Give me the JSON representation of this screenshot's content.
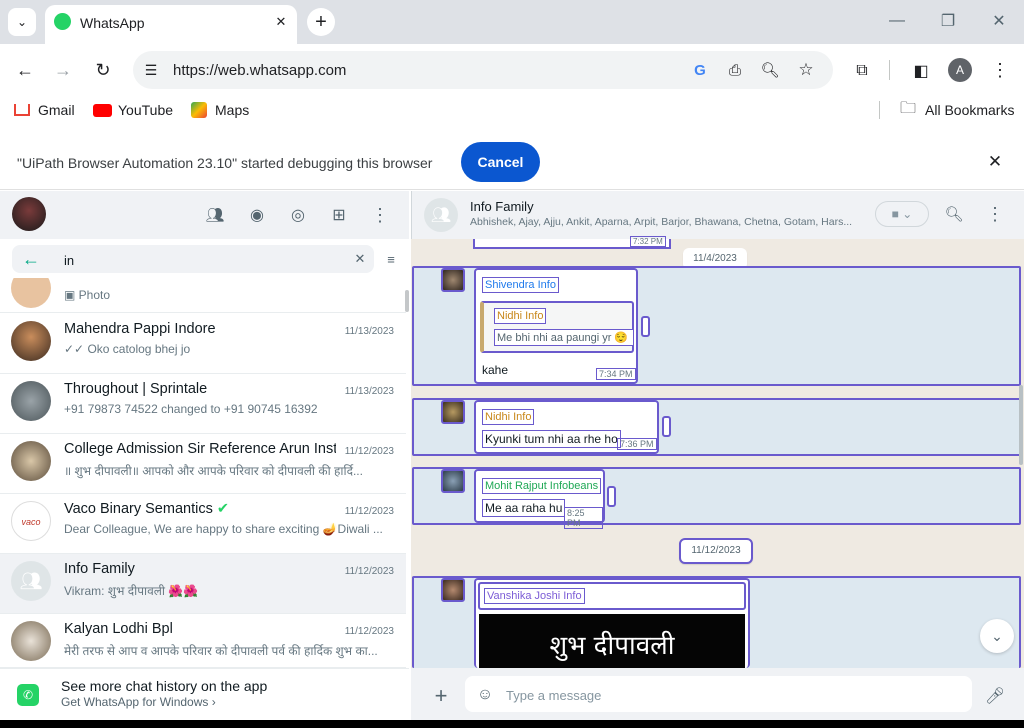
{
  "browser": {
    "tab_title": "WhatsApp",
    "url": "https://web.whatsapp.com",
    "bookmarks": [
      "Gmail",
      "YouTube",
      "Maps"
    ],
    "all_bookmarks": "All Bookmarks",
    "profile_initial": "A"
  },
  "debug_bar": {
    "message": "\"UiPath Browser Automation 23.10\" started debugging this browser",
    "cancel_label": "Cancel"
  },
  "search": {
    "value": "in"
  },
  "chats": [
    {
      "name": "Mahendra Pappi Indore",
      "date": "11/13/2023",
      "snippet": "✓✓ Oko catolog bhej jo"
    },
    {
      "name": "Throughout | Sprintale",
      "date": "11/13/2023",
      "snippet": "+91 79873 74522 changed to +91 90745 16392"
    },
    {
      "name": "College Admission Sir Reference Arun Inst...",
      "date": "11/12/2023",
      "snippet": "॥ शुभ दीपावली॥ आपको और आपके परिवार को दीपावली की हार्दि..."
    },
    {
      "name": "Vaco Binary Semantics",
      "date": "11/12/2023",
      "snippet": "Dear Colleague, We are happy to share exciting 🪔Diwali ..."
    },
    {
      "name": "Info Family",
      "date": "11/12/2023",
      "snippet": "Vikram: शुभ दीपावली 🌺🌺"
    },
    {
      "name": "Kalyan Lodhi Bpl",
      "date": "11/12/2023",
      "snippet": "मेरी तरफ से आप व आपके परिवार को दीपावली पर्व की हार्दिक शुभ का..."
    }
  ],
  "partial_chat_snippet": "Photo",
  "footer": {
    "title": "See more chat history on the app",
    "subtitle": "Get WhatsApp for Windows"
  },
  "conversation": {
    "name": "Info Family",
    "members": "Abhishek, Ajay, Ajju, Ankit, Aparna, Arpit, Barjor, Bhawana, Chetna, Gotam, Hars...",
    "top_time": "7:32 PM",
    "date1": "11/4/2023",
    "msg1": {
      "sender": "Shivendra Info",
      "quote_sender": "Nidhi Info",
      "quote_text": "Me bhi nhi aa paungi yr 😌",
      "text": "kahe",
      "time": "7:34 PM"
    },
    "msg2": {
      "sender": "Nidhi Info",
      "text": "Kyunki tum nhi aa rhe ho",
      "time": "7:36 PM"
    },
    "msg3": {
      "sender": "Mohit Rajput Infobeans",
      "text": "Me aa raha hu",
      "time": "8:25 PM"
    },
    "date2": "11/12/2023",
    "msg4": {
      "sender": "Vanshika Joshi Info",
      "image_text": "शुभ दीपावली"
    }
  },
  "composer": {
    "placeholder": "Type a message"
  },
  "colors": {
    "accent": "#00a884",
    "highlight": "#6a5acd",
    "button": "#0b57d0"
  }
}
